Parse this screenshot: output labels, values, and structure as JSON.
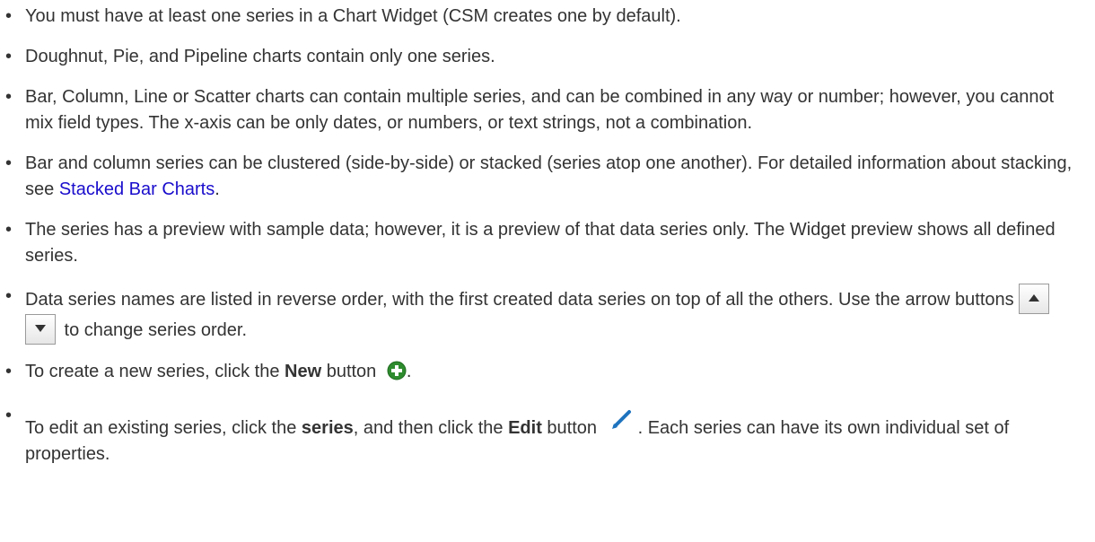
{
  "bullets": [
    {
      "text": "You must have at least one series in a Chart Widget (CSM creates one by default)."
    },
    {
      "text": "Doughnut, Pie, and Pipeline charts contain only one series."
    },
    {
      "text": "Bar, Column, Line or Scatter charts can contain multiple series, and can be combined in any way or number; however, you cannot mix field types. The x-axis can be only dates, or numbers, or text strings, not a combination."
    },
    {
      "text": "Bar and column series can be clustered (side-by-side) or stacked (series atop one another). For detailed information about stacking, see ",
      "link": "Stacked Bar Charts",
      "end": "."
    },
    {
      "text": "The series has a preview with sample data; however, it is a preview of that data series only. The Widget preview shows all defined series."
    },
    {
      "text": "Data series names are listed in reverse order, with the first created data series on top of all the others. Use the arrow buttons ",
      "end": " to change series order."
    },
    {
      "pre": "To create a new series, click the ",
      "bold": "New",
      "post": " button ",
      "end": "."
    },
    {
      "pre": "To edit an existing series, click the ",
      "bold1": "series",
      "mid": ", and then click the ",
      "bold2": "Edit",
      "post": " button ",
      "end": ". Each series can have its own individual set of properties."
    }
  ],
  "colors": {
    "text": "#333333",
    "link": "#1a0dcc",
    "plus_icon": "#2e8b2e",
    "pencil_icon": "#1e73be"
  },
  "icons": [
    "arrow-up-icon",
    "arrow-down-icon",
    "plus-circle-icon",
    "pencil-icon"
  ]
}
